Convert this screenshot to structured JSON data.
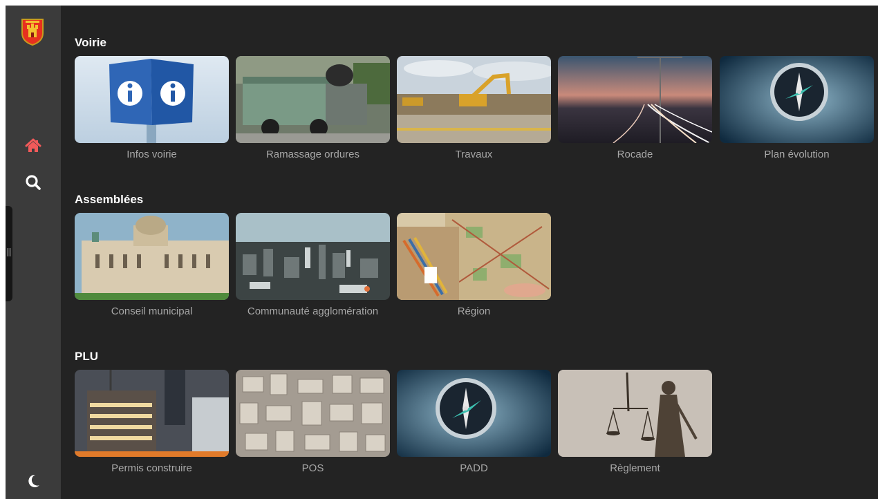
{
  "sidebar": {
    "logo_icon": "city-coat-of-arms-icon",
    "items": [
      {
        "name": "home",
        "icon": "home-icon",
        "color": "#f25a5a"
      },
      {
        "name": "search",
        "icon": "search-icon",
        "color": "#ffffff"
      }
    ],
    "theme_toggle_icon": "moon-icon"
  },
  "sections": [
    {
      "title": "Voirie",
      "cards": [
        {
          "label": "Infos voirie",
          "image": "info-sign-cube"
        },
        {
          "label": "Ramassage ordures",
          "image": "garbage-truck"
        },
        {
          "label": "Travaux",
          "image": "excavator-construction-site"
        },
        {
          "label": "Rocade",
          "image": "highway-dusk-light-trails"
        },
        {
          "label": "Plan évolution",
          "image": "compass-on-map"
        }
      ]
    },
    {
      "title": "Assemblées",
      "cards": [
        {
          "label": "Conseil municipal",
          "image": "city-hall-building"
        },
        {
          "label": "Communauté agglomération",
          "image": "aerial-city-view"
        },
        {
          "label": "Région",
          "image": "regional-map-with-pencils"
        }
      ]
    },
    {
      "title": "PLU",
      "cards": [
        {
          "label": "Permis construire",
          "image": "building-under-construction"
        },
        {
          "label": "POS",
          "image": "white-city-model"
        },
        {
          "label": "PADD",
          "image": "compass-on-map"
        },
        {
          "label": "Règlement",
          "image": "lady-justice-statue"
        }
      ]
    }
  ]
}
